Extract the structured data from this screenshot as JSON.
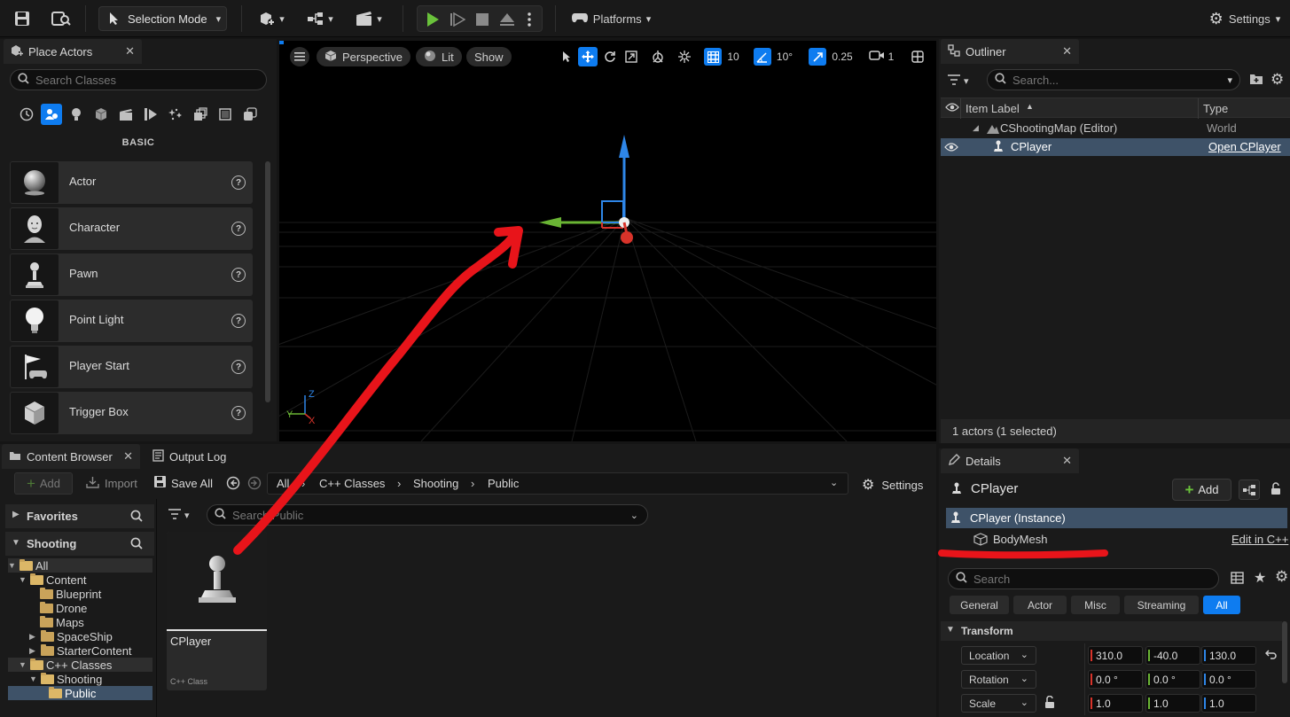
{
  "toolbar": {
    "selection_mode": "Selection Mode",
    "platforms": "Platforms",
    "settings": "Settings"
  },
  "place_actors": {
    "tab_title": "Place Actors",
    "search_placeholder": "Search Classes",
    "category_title": "BASIC",
    "category_icons": [
      "recent-icon",
      "basic-icon",
      "lights-icon",
      "shapes-icon",
      "cinematic-icon",
      "visual-effects-icon",
      "volumes-icon",
      "all-classes-icon",
      "geometry-icon",
      "misc-icon",
      "more-icon"
    ],
    "items": [
      {
        "label": "Actor",
        "icon": "sphere-icon"
      },
      {
        "label": "Character",
        "icon": "character-icon"
      },
      {
        "label": "Pawn",
        "icon": "pawn-icon"
      },
      {
        "label": "Point Light",
        "icon": "bulb-icon"
      },
      {
        "label": "Player Start",
        "icon": "flag-icon"
      },
      {
        "label": "Trigger Box",
        "icon": "box-icon"
      }
    ]
  },
  "viewport": {
    "perspective": "Perspective",
    "lit": "Lit",
    "show": "Show",
    "grid_snap": "10",
    "rotation_snap": "10°",
    "scale_snap": "0.25",
    "camera_speed": "1",
    "axis_x": "X",
    "axis_y": "Y",
    "axis_z": "Z"
  },
  "outliner": {
    "tab_title": "Outliner",
    "search_placeholder": "Search...",
    "col_label": "Item Label",
    "col_type": "Type",
    "rows": [
      {
        "label": "CShootingMap (Editor)",
        "type": "World"
      },
      {
        "label": "CPlayer",
        "type": "Open CPlayer"
      }
    ],
    "status": "1 actors (1 selected)"
  },
  "details": {
    "tab_title": "Details",
    "actor_name": "CPlayer",
    "add_label": "Add",
    "instance_label": "CPlayer (Instance)",
    "component_label": "BodyMesh",
    "edit_link": "Edit in C++",
    "search_placeholder": "Search",
    "filters": [
      "General",
      "Actor",
      "Misc",
      "Streaming",
      "All"
    ],
    "active_filter": "All",
    "section": "Transform",
    "props": [
      {
        "label": "Location",
        "x": "310.0",
        "y": "-40.0",
        "z": "130.0"
      },
      {
        "label": "Rotation",
        "x": "0.0 °",
        "y": "0.0 °",
        "z": "0.0 °"
      },
      {
        "label": "Scale",
        "x": "1.0",
        "y": "1.0",
        "z": "1.0"
      }
    ]
  },
  "content_browser": {
    "tab_title": "Content Browser",
    "output_log": "Output Log",
    "add": "Add",
    "import": "Import",
    "save_all": "Save All",
    "breadcrumb": [
      "All",
      "C++ Classes",
      "Shooting",
      "Public"
    ],
    "settings": "Settings",
    "favorites": "Favorites",
    "collection": "Shooting",
    "search_placeholder": "Search Public",
    "tree": [
      {
        "label": "All",
        "depth": 0
      },
      {
        "label": "Content",
        "depth": 1
      },
      {
        "label": "Blueprint",
        "depth": 2
      },
      {
        "label": "Drone",
        "depth": 2
      },
      {
        "label": "Maps",
        "depth": 2
      },
      {
        "label": "SpaceShip",
        "depth": 2
      },
      {
        "label": "StarterContent",
        "depth": 2
      },
      {
        "label": "C++ Classes",
        "depth": 1
      },
      {
        "label": "Shooting",
        "depth": 2
      },
      {
        "label": "Public",
        "depth": 3
      }
    ],
    "asset": {
      "name": "CPlayer",
      "kind": "C++ Class"
    }
  },
  "colors": {
    "accent_blue": "#0e7cf0",
    "play_green": "#6ac23b",
    "annotation_red": "#e8141a",
    "axis_x": "#d8332a",
    "axis_y": "#6ab534",
    "axis_z": "#2e86e8"
  }
}
